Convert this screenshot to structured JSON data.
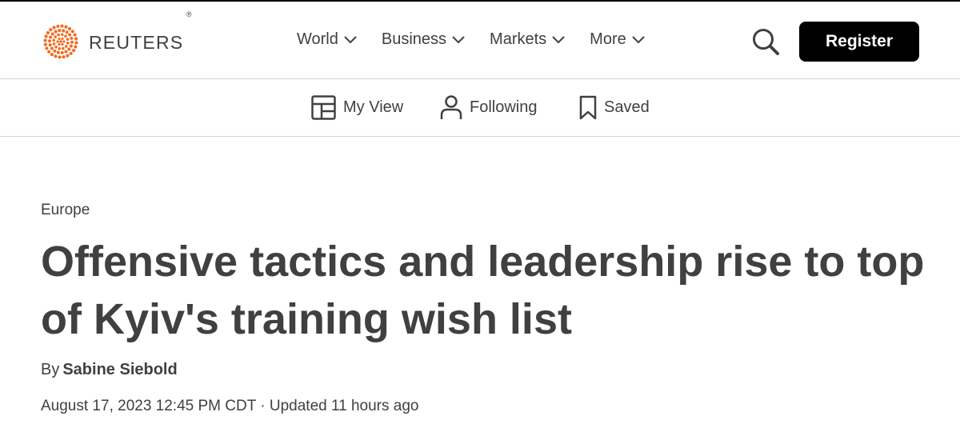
{
  "header": {
    "logo_text": "REUTERS",
    "logo_mark": "®",
    "nav": [
      {
        "label": "World"
      },
      {
        "label": "Business"
      },
      {
        "label": "Markets"
      },
      {
        "label": "More"
      }
    ],
    "register_label": "Register"
  },
  "subnav": {
    "my_view": "My View",
    "following": "Following",
    "saved": "Saved"
  },
  "article": {
    "category": "Europe",
    "headline": "Offensive tactics and leadership rise to top of Kyiv's training wish list",
    "by_prefix": "By",
    "author": "Sabine Siebold",
    "dateline": "August 17, 2023 12:45 PM CDT · Updated 11 hours ago"
  },
  "colors": {
    "brand_orange": "#f26b21",
    "text": "#404040",
    "button_bg": "#000000"
  },
  "icons": [
    "reuters-logo-icon",
    "chevron-down-icon",
    "search-icon",
    "layout-icon",
    "person-icon",
    "bookmark-icon"
  ]
}
